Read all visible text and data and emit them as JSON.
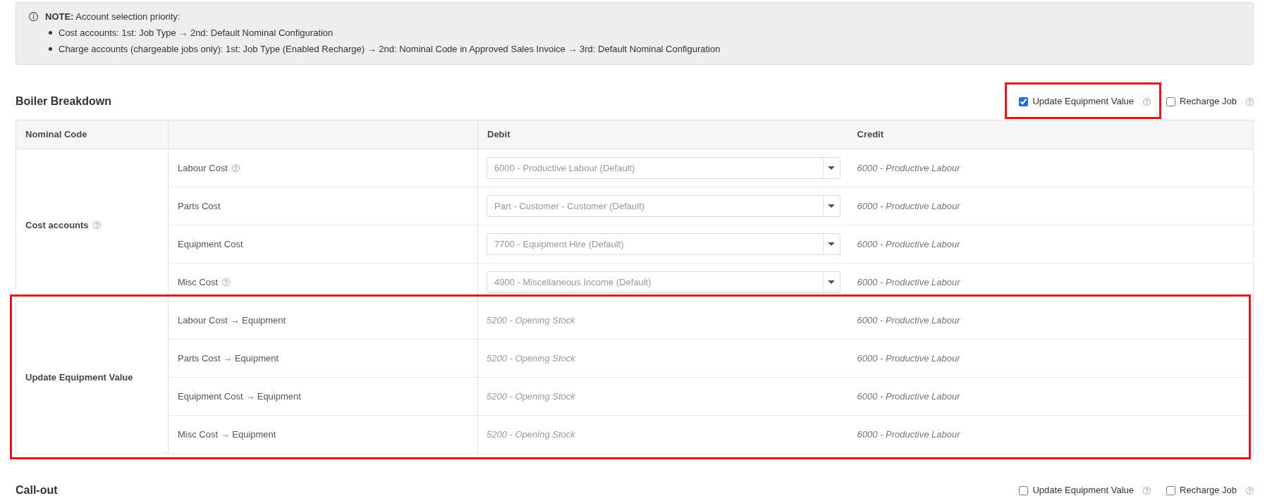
{
  "note": {
    "heading": "**NOTE:** Account selection priority:",
    "items": [
      "Cost accounts: 1st: Job Type → 2nd: Default Nominal Configuration",
      "Charge accounts (chargeable jobs only): 1st: Job Type (Enabled Recharge) → 2nd: Nominal Code in Approved Sales Invoice → 3rd: Default Nominal Configuration"
    ]
  },
  "sections": [
    {
      "title": "Boiler Breakdown",
      "options": [
        {
          "label": "Update Equipment Value",
          "checked": true,
          "help": true,
          "highlighted": true
        },
        {
          "label": "Recharge Job",
          "checked": false,
          "help": true,
          "highlighted": false
        }
      ],
      "table": {
        "header": {
          "nominal_code": "Nominal Code",
          "debit": "Debit",
          "credit": "Credit"
        },
        "groups": [
          {
            "label": "Cost accounts",
            "help": true,
            "highlighted": false,
            "rows": [
              {
                "label": "Labour Cost",
                "help": true,
                "debit": {
                  "kind": "dropdown",
                  "value": "6000 - Productive Labour (Default)"
                },
                "credit": "6000 - Productive Labour"
              },
              {
                "label": "Parts Cost",
                "help": false,
                "debit": {
                  "kind": "dropdown",
                  "value": "Part - Customer - Customer (Default)"
                },
                "credit": "6000 - Productive Labour"
              },
              {
                "label": "Equipment Cost",
                "help": false,
                "debit": {
                  "kind": "dropdown",
                  "value": "7700 - Equipment Hire (Default)"
                },
                "credit": "6000 - Productive Labour"
              },
              {
                "label": "Misc Cost",
                "help": true,
                "debit": {
                  "kind": "dropdown",
                  "value": "4900 - Miscellaneous Income (Default)"
                },
                "credit": "6000 - Productive Labour"
              }
            ]
          },
          {
            "label": "Update Equipment Value",
            "help": false,
            "highlighted": true,
            "rows": [
              {
                "label": "Labour Cost → Equipment",
                "help": false,
                "debit": {
                  "kind": "text",
                  "value": "5200 - Opening Stock"
                },
                "credit": "6000 - Productive Labour"
              },
              {
                "label": "Parts Cost → Equipment",
                "help": false,
                "debit": {
                  "kind": "text",
                  "value": "5200 - Opening Stock"
                },
                "credit": "6000 - Productive Labour"
              },
              {
                "label": "Equipment Cost → Equipment",
                "help": false,
                "debit": {
                  "kind": "text",
                  "value": "5200 - Opening Stock"
                },
                "credit": "6000 - Productive Labour"
              },
              {
                "label": "Misc Cost → Equipment",
                "help": false,
                "debit": {
                  "kind": "text",
                  "value": "5200 - Opening Stock"
                },
                "credit": "6000 - Productive Labour"
              }
            ]
          }
        ]
      }
    },
    {
      "title": "Call-out",
      "options": [
        {
          "label": "Update Equipment Value",
          "checked": false,
          "help": true,
          "highlighted": false
        },
        {
          "label": "Recharge Job",
          "checked": false,
          "help": true,
          "highlighted": false
        }
      ]
    }
  ]
}
